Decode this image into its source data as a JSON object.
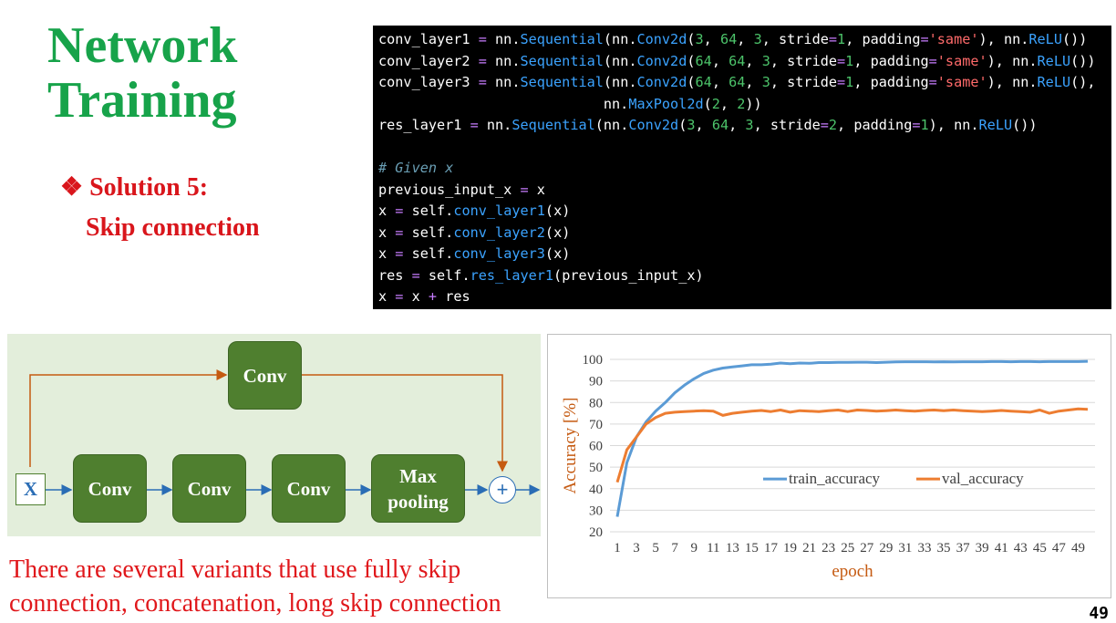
{
  "title": {
    "line1": "Network",
    "line2": "Training"
  },
  "solution": {
    "bullet": "❖",
    "label": "Solution 5:",
    "sub": "Skip connection"
  },
  "diagram": {
    "input": "X",
    "skip_conv": "Conv",
    "blocks": [
      "Conv",
      "Conv",
      "Conv"
    ],
    "pool_line1": "Max",
    "pool_line2": "pooling",
    "sum": "+"
  },
  "note": {
    "line1": "There are several variants that use fully skip",
    "line2": "connection, concatenation, long skip connection"
  },
  "page_number": "49",
  "colors": {
    "title": "#17a34a",
    "accent_red": "#d9161c",
    "train": "#5b9bd5",
    "val": "#ed7d31"
  },
  "chart_data": {
    "type": "line",
    "xlabel": "epoch",
    "ylabel": "Accuracy [%]",
    "ylim": [
      20,
      100
    ],
    "yticks": [
      20,
      30,
      40,
      50,
      60,
      70,
      80,
      90,
      100
    ],
    "xlim": [
      1,
      50
    ],
    "xticks": [
      1,
      3,
      5,
      7,
      9,
      11,
      13,
      15,
      17,
      19,
      21,
      23,
      25,
      27,
      29,
      31,
      33,
      35,
      37,
      39,
      41,
      43,
      45,
      47,
      49
    ],
    "grid": "horizontal",
    "legend": "center-right",
    "series": [
      {
        "name": "train_accuracy",
        "color": "#5b9bd5",
        "values": [
          27,
          52,
          64,
          71,
          76,
          80,
          84.5,
          88,
          91,
          93.5,
          95,
          96,
          96.5,
          97,
          97.5,
          97.5,
          97.8,
          98.3,
          98,
          98.3,
          98.2,
          98.5,
          98.5,
          98.6,
          98.6,
          98.7,
          98.7,
          98.5,
          98.7,
          98.8,
          98.9,
          98.9,
          98.9,
          98.8,
          98.9,
          98.8,
          98.9,
          98.9,
          98.9,
          99,
          99,
          98.9,
          99,
          99,
          98.9,
          99,
          99,
          99,
          99,
          99.1
        ]
      },
      {
        "name": "val_accuracy",
        "color": "#ed7d31",
        "values": [
          43,
          58,
          64,
          70,
          73,
          75,
          75.5,
          75.8,
          76,
          76.2,
          76,
          74,
          75,
          75.5,
          76,
          76.3,
          75.8,
          76.5,
          75.5,
          76.2,
          76,
          75.8,
          76.2,
          76.5,
          75.8,
          76.5,
          76.3,
          76,
          76.2,
          76.5,
          76.2,
          76,
          76.3,
          76.5,
          76.2,
          76.5,
          76.2,
          76,
          75.8,
          76,
          76.3,
          76,
          75.8,
          75.5,
          76.5,
          75,
          76,
          76.5,
          77,
          76.8
        ]
      }
    ]
  }
}
